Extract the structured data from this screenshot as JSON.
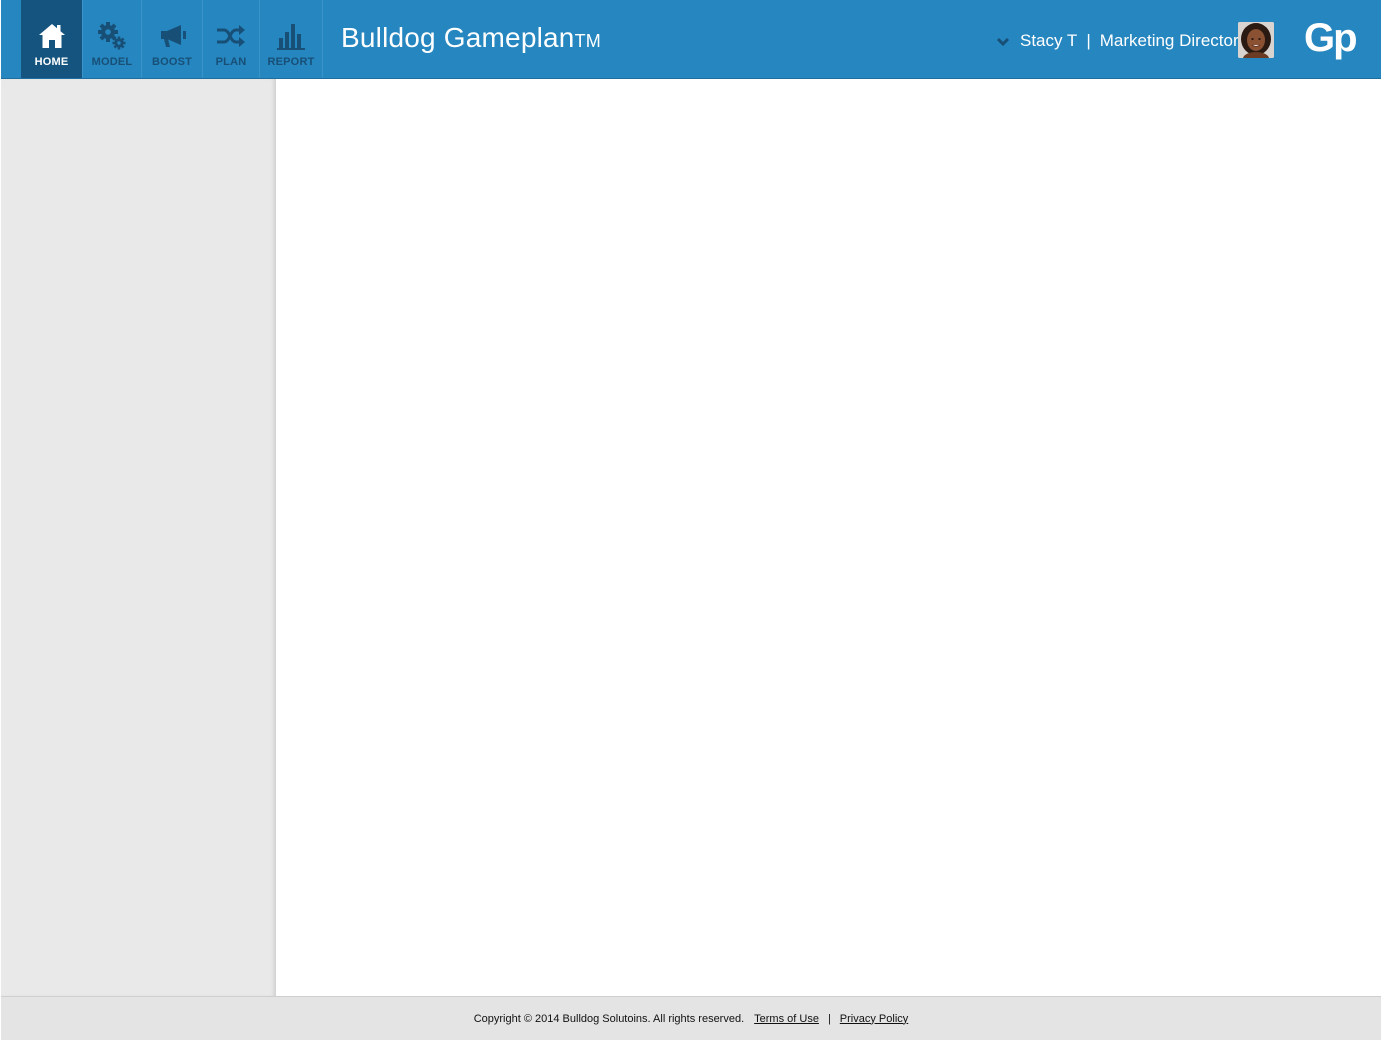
{
  "header": {
    "nav": [
      {
        "label": "HOME",
        "icon": "home-icon",
        "active": true
      },
      {
        "label": "MODEL",
        "icon": "gears-icon",
        "active": false
      },
      {
        "label": "BOOST",
        "icon": "megaphone-icon",
        "active": false
      },
      {
        "label": "PLAN",
        "icon": "shuffle-icon",
        "active": false
      },
      {
        "label": "REPORT",
        "icon": "bar-chart-icon",
        "active": false
      }
    ],
    "title": "Bulldog Gameplan",
    "trademark": "TM",
    "user": {
      "name": "Stacy T",
      "separator": "|",
      "role": "Marketing Director"
    },
    "logo": "Gp"
  },
  "footer": {
    "copyright": "Copyright © 2014 Bulldog Solutoins. All rights reserved.",
    "terms": "Terms of Use",
    "separator": "|",
    "privacy": "Privacy Policy"
  },
  "colors": {
    "header_bg": "#2686bf",
    "nav_active_bg": "#14547f",
    "nav_icon": "#174f77",
    "sidebar_bg": "#e9e9e9",
    "footer_bg": "#e4e4e4"
  }
}
